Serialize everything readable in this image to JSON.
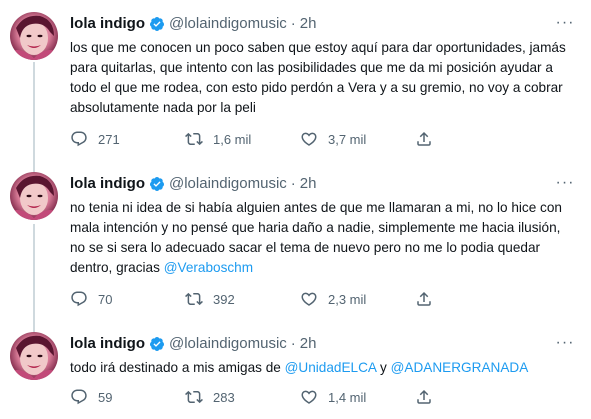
{
  "tweets": [
    {
      "name": "lola indigo",
      "handle": "@lolaindigomusic",
      "dot": "·",
      "time": "2h",
      "text_parts": [
        {
          "text": "los que me conocen un poco saben que estoy aquí para dar oportunidades, jamás para quitarlas, que intento con las posibilidades que me da mi posición ayudar a todo el que me rodea, con esto pido perdón a Vera y a su gremio, no voy a cobrar absolutamente nada por la peli",
          "mention": false
        }
      ],
      "replies": "271",
      "retweets": "1,6 mil",
      "likes": "3,7 mil"
    },
    {
      "name": "lola indigo",
      "handle": "@lolaindigomusic",
      "dot": "·",
      "time": "2h",
      "text_parts": [
        {
          "text": "no tenia ni idea de si había alguien antes de que me llamaran a mi, no lo hice con mala intención y no pensé que haria daño a nadie, simplemente me hacia ilusión, no se si sera lo adecuado sacar el tema de nuevo pero no me lo podia quedar dentro, gracias ",
          "mention": false
        },
        {
          "text": "@Veraboschm",
          "mention": true
        }
      ],
      "replies": "70",
      "retweets": "392",
      "likes": "2,3 mil"
    },
    {
      "name": "lola indigo",
      "handle": "@lolaindigomusic",
      "dot": "·",
      "time": "2h",
      "text_parts": [
        {
          "text": "todo irá destinado a mis amigas de ",
          "mention": false
        },
        {
          "text": "@UnidadELCA",
          "mention": true
        },
        {
          "text": " y ",
          "mention": false
        },
        {
          "text": "@ADANERGRANADA",
          "mention": true
        }
      ],
      "replies": "59",
      "retweets": "283",
      "likes": "1,4 mil"
    }
  ],
  "icons": {
    "verified": "verified-badge-icon",
    "more": "more-options-icon",
    "reply": "reply-icon",
    "retweet": "retweet-icon",
    "like": "like-icon",
    "share": "share-icon"
  },
  "colors": {
    "accent": "#1d9bf0",
    "secondary_text": "#536471",
    "primary_text": "#0f1419"
  }
}
